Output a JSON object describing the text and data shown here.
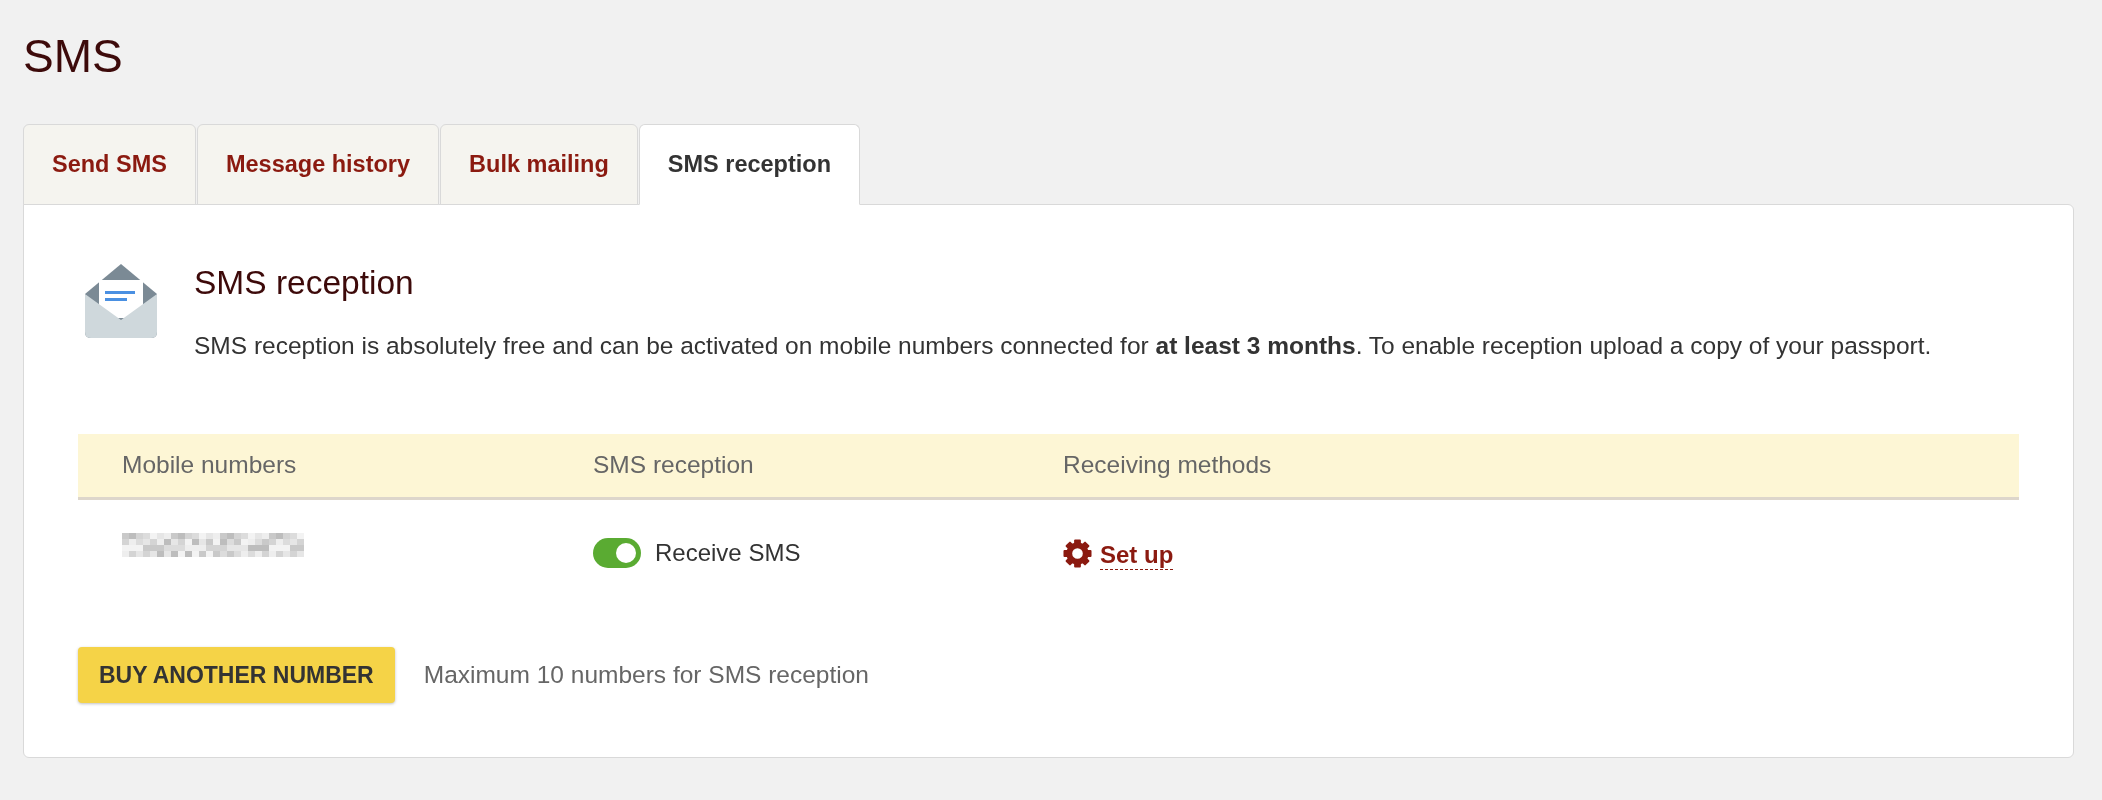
{
  "page": {
    "title": "SMS"
  },
  "tabs": [
    {
      "label": "Send SMS",
      "selected": false
    },
    {
      "label": "Message history",
      "selected": false
    },
    {
      "label": "Bulk mailing",
      "selected": false
    },
    {
      "label": "SMS reception",
      "selected": true
    }
  ],
  "intro": {
    "heading": "SMS reception",
    "text": "SMS reception is absolutely free and can be activated on mobile numbers connected for **at least 3 months**. To enable reception upload a copy of your passport."
  },
  "table": {
    "columns": [
      "Mobile numbers",
      "SMS reception",
      "Receiving methods"
    ],
    "rows": [
      {
        "number_redacted": true,
        "reception": {
          "on": true,
          "label": "Receive SMS"
        },
        "method": {
          "label": "Set up"
        }
      }
    ]
  },
  "footer": {
    "button": "BUY ANOTHER NUMBER",
    "note": "Maximum 10 numbers for SMS reception"
  }
}
